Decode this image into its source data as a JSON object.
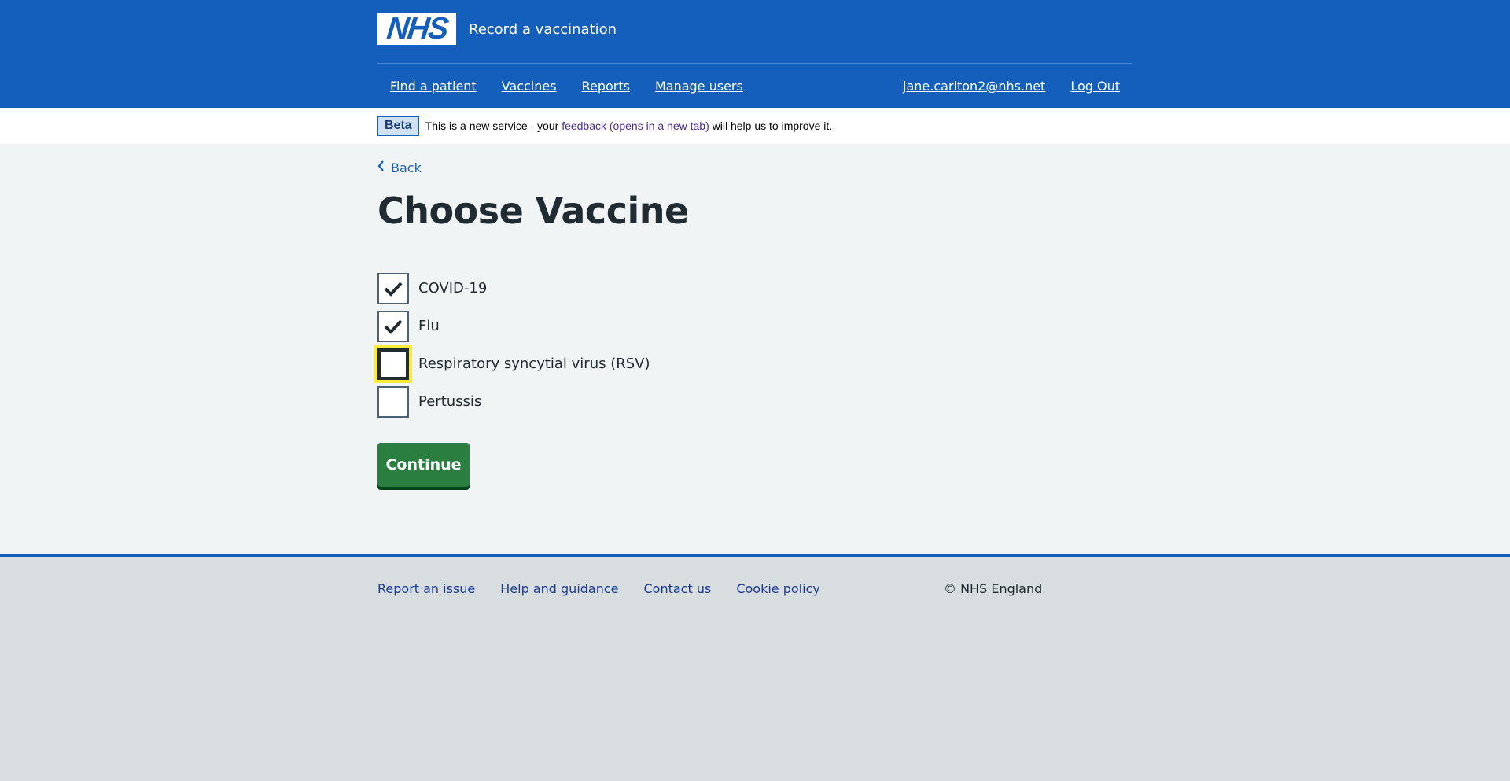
{
  "header": {
    "logo_text": "NHS",
    "service_name": "Record a vaccination",
    "nav_left": [
      {
        "label": "Find a patient"
      },
      {
        "label": "Vaccines"
      },
      {
        "label": "Reports"
      },
      {
        "label": "Manage users"
      }
    ],
    "nav_right": [
      {
        "label": "jane.carlton2@nhs.net"
      },
      {
        "label": "Log Out"
      }
    ]
  },
  "beta_banner": {
    "tag": "Beta",
    "text_before": "This is a new service - your ",
    "link_text": "feedback (opens in a new tab)",
    "text_after": " will help us to improve it."
  },
  "main": {
    "back_label": "Back",
    "title": "Choose Vaccine",
    "options": [
      {
        "label": "COVID-19",
        "checked": true,
        "focused": false
      },
      {
        "label": "Flu",
        "checked": true,
        "focused": false
      },
      {
        "label": "Respiratory syncytial virus (RSV)",
        "checked": false,
        "focused": true
      },
      {
        "label": "Pertussis",
        "checked": false,
        "focused": false
      }
    ],
    "continue_label": "Continue"
  },
  "footer": {
    "links": [
      {
        "label": "Report an issue"
      },
      {
        "label": "Help and guidance"
      },
      {
        "label": "Contact us"
      },
      {
        "label": "Cookie policy"
      }
    ],
    "copyright": "© NHS England"
  },
  "colors": {
    "header_blue": "#145fbb",
    "button_green": "#2a7f40",
    "focus_yellow": "#ffeb3b",
    "page_bg": "#f0f4f5",
    "footer_bg": "#d8dde0"
  }
}
